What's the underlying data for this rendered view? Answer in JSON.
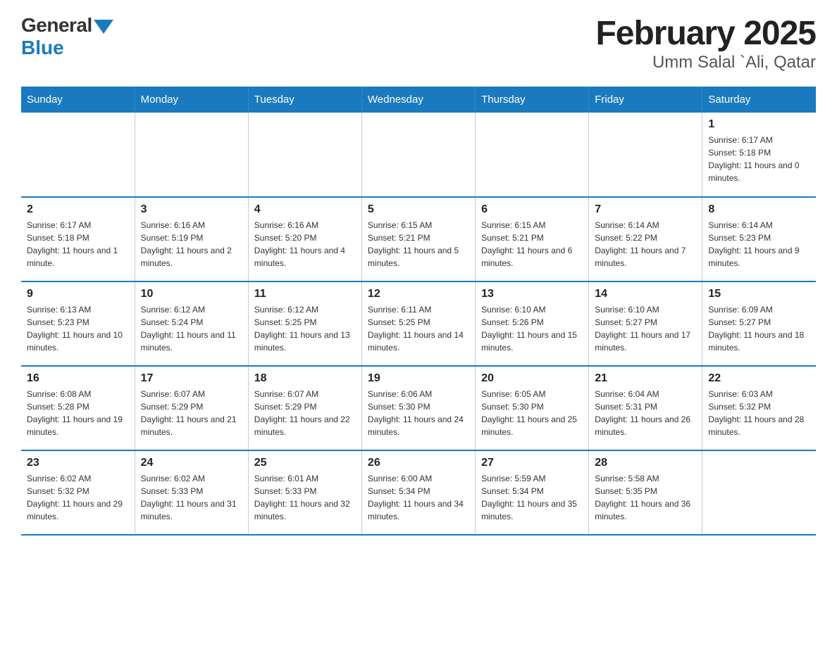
{
  "logo": {
    "general": "General",
    "blue": "Blue"
  },
  "title": "February 2025",
  "subtitle": "Umm Salal `Ali, Qatar",
  "days_of_week": [
    "Sunday",
    "Monday",
    "Tuesday",
    "Wednesday",
    "Thursday",
    "Friday",
    "Saturday"
  ],
  "weeks": [
    {
      "days": [
        {
          "num": "",
          "info": ""
        },
        {
          "num": "",
          "info": ""
        },
        {
          "num": "",
          "info": ""
        },
        {
          "num": "",
          "info": ""
        },
        {
          "num": "",
          "info": ""
        },
        {
          "num": "",
          "info": ""
        },
        {
          "num": "1",
          "info": "Sunrise: 6:17 AM\nSunset: 5:18 PM\nDaylight: 11 hours and 0 minutes."
        }
      ]
    },
    {
      "days": [
        {
          "num": "2",
          "info": "Sunrise: 6:17 AM\nSunset: 5:18 PM\nDaylight: 11 hours and 1 minute."
        },
        {
          "num": "3",
          "info": "Sunrise: 6:16 AM\nSunset: 5:19 PM\nDaylight: 11 hours and 2 minutes."
        },
        {
          "num": "4",
          "info": "Sunrise: 6:16 AM\nSunset: 5:20 PM\nDaylight: 11 hours and 4 minutes."
        },
        {
          "num": "5",
          "info": "Sunrise: 6:15 AM\nSunset: 5:21 PM\nDaylight: 11 hours and 5 minutes."
        },
        {
          "num": "6",
          "info": "Sunrise: 6:15 AM\nSunset: 5:21 PM\nDaylight: 11 hours and 6 minutes."
        },
        {
          "num": "7",
          "info": "Sunrise: 6:14 AM\nSunset: 5:22 PM\nDaylight: 11 hours and 7 minutes."
        },
        {
          "num": "8",
          "info": "Sunrise: 6:14 AM\nSunset: 5:23 PM\nDaylight: 11 hours and 9 minutes."
        }
      ]
    },
    {
      "days": [
        {
          "num": "9",
          "info": "Sunrise: 6:13 AM\nSunset: 5:23 PM\nDaylight: 11 hours and 10 minutes."
        },
        {
          "num": "10",
          "info": "Sunrise: 6:12 AM\nSunset: 5:24 PM\nDaylight: 11 hours and 11 minutes."
        },
        {
          "num": "11",
          "info": "Sunrise: 6:12 AM\nSunset: 5:25 PM\nDaylight: 11 hours and 13 minutes."
        },
        {
          "num": "12",
          "info": "Sunrise: 6:11 AM\nSunset: 5:25 PM\nDaylight: 11 hours and 14 minutes."
        },
        {
          "num": "13",
          "info": "Sunrise: 6:10 AM\nSunset: 5:26 PM\nDaylight: 11 hours and 15 minutes."
        },
        {
          "num": "14",
          "info": "Sunrise: 6:10 AM\nSunset: 5:27 PM\nDaylight: 11 hours and 17 minutes."
        },
        {
          "num": "15",
          "info": "Sunrise: 6:09 AM\nSunset: 5:27 PM\nDaylight: 11 hours and 18 minutes."
        }
      ]
    },
    {
      "days": [
        {
          "num": "16",
          "info": "Sunrise: 6:08 AM\nSunset: 5:28 PM\nDaylight: 11 hours and 19 minutes."
        },
        {
          "num": "17",
          "info": "Sunrise: 6:07 AM\nSunset: 5:29 PM\nDaylight: 11 hours and 21 minutes."
        },
        {
          "num": "18",
          "info": "Sunrise: 6:07 AM\nSunset: 5:29 PM\nDaylight: 11 hours and 22 minutes."
        },
        {
          "num": "19",
          "info": "Sunrise: 6:06 AM\nSunset: 5:30 PM\nDaylight: 11 hours and 24 minutes."
        },
        {
          "num": "20",
          "info": "Sunrise: 6:05 AM\nSunset: 5:30 PM\nDaylight: 11 hours and 25 minutes."
        },
        {
          "num": "21",
          "info": "Sunrise: 6:04 AM\nSunset: 5:31 PM\nDaylight: 11 hours and 26 minutes."
        },
        {
          "num": "22",
          "info": "Sunrise: 6:03 AM\nSunset: 5:32 PM\nDaylight: 11 hours and 28 minutes."
        }
      ]
    },
    {
      "days": [
        {
          "num": "23",
          "info": "Sunrise: 6:02 AM\nSunset: 5:32 PM\nDaylight: 11 hours and 29 minutes."
        },
        {
          "num": "24",
          "info": "Sunrise: 6:02 AM\nSunset: 5:33 PM\nDaylight: 11 hours and 31 minutes."
        },
        {
          "num": "25",
          "info": "Sunrise: 6:01 AM\nSunset: 5:33 PM\nDaylight: 11 hours and 32 minutes."
        },
        {
          "num": "26",
          "info": "Sunrise: 6:00 AM\nSunset: 5:34 PM\nDaylight: 11 hours and 34 minutes."
        },
        {
          "num": "27",
          "info": "Sunrise: 5:59 AM\nSunset: 5:34 PM\nDaylight: 11 hours and 35 minutes."
        },
        {
          "num": "28",
          "info": "Sunrise: 5:58 AM\nSunset: 5:35 PM\nDaylight: 11 hours and 36 minutes."
        },
        {
          "num": "",
          "info": ""
        }
      ]
    }
  ]
}
